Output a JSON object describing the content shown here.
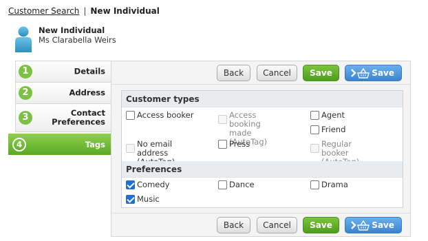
{
  "breadcrumb": {
    "link": "Customer Search",
    "separator": "|",
    "current": "New Individual"
  },
  "header": {
    "title": "New Individual",
    "subtitle": "Ms Clarabella Weirs"
  },
  "steps": [
    {
      "num": "1",
      "label": "Details"
    },
    {
      "num": "2",
      "label": "Address"
    },
    {
      "num": "3",
      "label": "Contact\nPreferences"
    },
    {
      "num": "4",
      "label": "Tags"
    }
  ],
  "toolbar": {
    "back": "Back",
    "cancel": "Cancel",
    "save": "Save",
    "save_basket": "Save"
  },
  "sections": {
    "customer_types": {
      "title": "Customer types",
      "options": [
        {
          "label": "Access booker",
          "checked": false,
          "disabled": false
        },
        {
          "label": "Access booking\nmade (AutoTag)",
          "checked": false,
          "disabled": true
        },
        {
          "label": "Agent",
          "checked": false,
          "disabled": false
        },
        {
          "label": "Friend",
          "checked": false,
          "disabled": false
        },
        {
          "label": "No email address\n(AutoTag)",
          "checked": false,
          "disabled": true
        },
        {
          "label": "Press",
          "checked": false,
          "disabled": false
        },
        {
          "label": "Regular booker\n(AutoTag)",
          "checked": false,
          "disabled": true
        }
      ]
    },
    "preferences": {
      "title": "Preferences",
      "options": [
        {
          "label": "Comedy",
          "checked": true,
          "disabled": false
        },
        {
          "label": "Dance",
          "checked": false,
          "disabled": false
        },
        {
          "label": "Drama",
          "checked": false,
          "disabled": false
        },
        {
          "label": "Music",
          "checked": true,
          "disabled": false
        }
      ]
    }
  },
  "colors": {
    "accent_green": "#7cc242",
    "save_blue": "#3b84cf",
    "check_blue": "#1f6fd6"
  }
}
